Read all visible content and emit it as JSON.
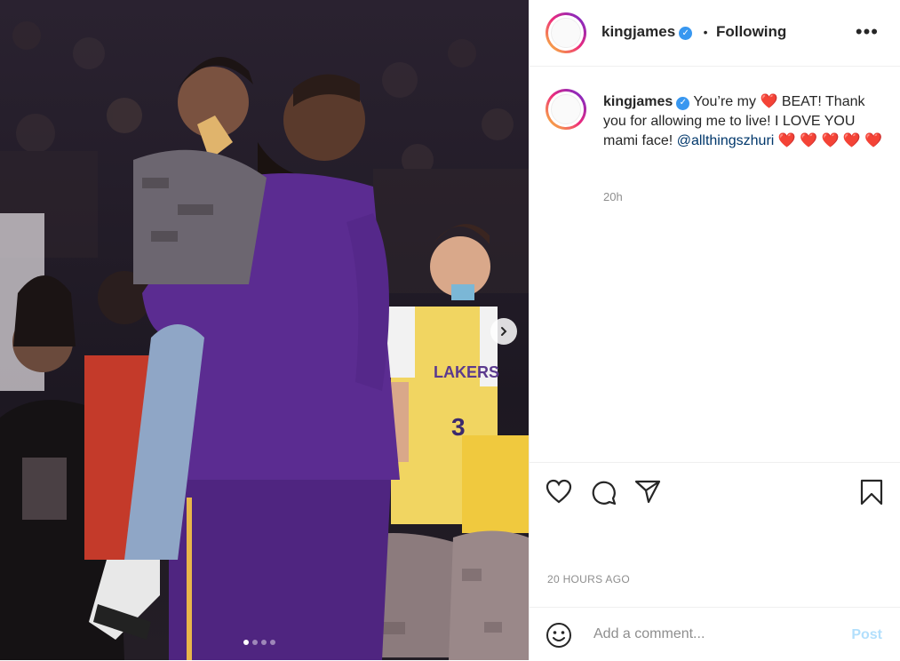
{
  "header": {
    "username": "kingjames",
    "separator": "•",
    "follow_status": "Following",
    "more_icon": "more-horizontal-icon"
  },
  "caption": {
    "username": "kingjames",
    "text_before_heart": "You’re my",
    "text_after_heart": "BEAT! Thank you for allowing me to live! I LOVE YOU mami face!",
    "mention": "@allthingszhuri",
    "hearts_after_mention": 5,
    "time_ago": "20h"
  },
  "media": {
    "next_icon": "chevron-right-icon",
    "slide_count": 4,
    "active_slide": 1
  },
  "actions": {
    "like_icon": "heart-icon",
    "comment_icon": "comment-icon",
    "share_icon": "paper-plane-icon",
    "save_icon": "bookmark-icon"
  },
  "post_date": "20 HOURS AGO",
  "comment": {
    "emoji_icon": "smiley-icon",
    "placeholder": "Add a comment...",
    "post_label": "Post"
  },
  "colors": {
    "verified": "#3897f0",
    "mention": "#00376b",
    "heart": "#e0245e",
    "post_disabled": "#b2dffc"
  }
}
